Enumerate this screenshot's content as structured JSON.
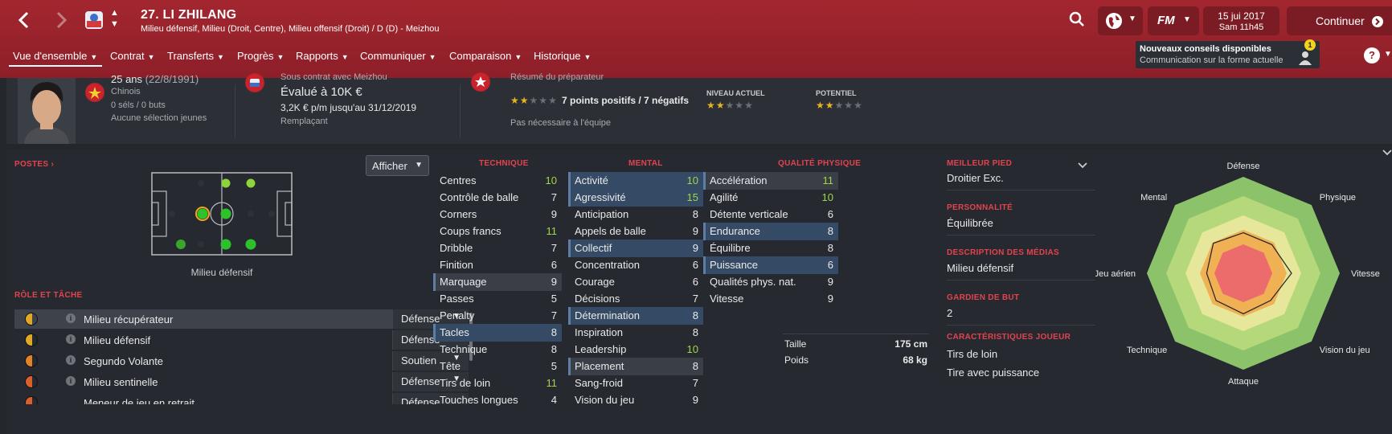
{
  "header": {
    "player_title": "27. LI ZHILANG",
    "player_positions": "Milieu défensif, Milieu (Droit, Centre), Milieu offensif (Droit) / D (D) - Meizhou",
    "date": "15 jui 2017",
    "time": "Sam 11h45",
    "continue_label": "Continuer",
    "fm_label": "FM",
    "back_icon": "chevron-left-icon",
    "forward_icon": "chevron-right-icon",
    "accent": "#a3262f"
  },
  "menu": [
    "Vue d'ensemble",
    "Contrat",
    "Transferts",
    "Progrès",
    "Rapports",
    "Communiquer",
    "Comparaison",
    "Historique"
  ],
  "tip": {
    "title": "Nouveaux conseils disponibles",
    "text": "Communication sur la forme actuelle",
    "count": "1"
  },
  "profile": {
    "age": "25 ans",
    "dob": "(22/8/1991)",
    "nationality": "Chinois",
    "caps": "0 séls / 0 buts",
    "youth": "Aucune sélection jeunes",
    "contract_with": "Sous contrat avec Meizhou",
    "value": "Évalué à 10K €",
    "wage": "3,2K € p/m jusqu'au 31/12/2019",
    "squad_status": "Remplaçant",
    "coach_summary_title": "Résumé du préparateur",
    "coach_summary": "7 points positifs / 7 négatifs",
    "coach_note": "Pas nécessaire à l'équipe",
    "current_ability_label": "NIVEAU ACTUEL",
    "potential_label": "POTENTIEL",
    "summary_stars": 1.5,
    "current_stars": 1.5,
    "potential_stars": 1.5
  },
  "positions": {
    "title": "POSTES",
    "show_button": "Afficher",
    "selected_label": "Milieu défensif"
  },
  "roles": {
    "title": "RÔLE ET TÂCHE",
    "items": [
      {
        "name": "Milieu récupérateur",
        "duty": "Défense"
      },
      {
        "name": "Milieu défensif",
        "duty": "Défense"
      },
      {
        "name": "Segundo Volante",
        "duty": "Soutien"
      },
      {
        "name": "Milieu sentinelle",
        "duty": "Défense"
      },
      {
        "name": "Meneur de jeu en retrait",
        "duty": "Défense"
      }
    ]
  },
  "technique": {
    "title": "TECHNIQUE",
    "rows": [
      {
        "n": "Centres",
        "v": "10"
      },
      {
        "n": "Contrôle de balle",
        "v": "7"
      },
      {
        "n": "Corners",
        "v": "9"
      },
      {
        "n": "Coups francs",
        "v": "11"
      },
      {
        "n": "Dribble",
        "v": "7"
      },
      {
        "n": "Finition",
        "v": "6"
      },
      {
        "n": "Marquage",
        "v": "9"
      },
      {
        "n": "Passes",
        "v": "5"
      },
      {
        "n": "Penalty",
        "v": "7"
      },
      {
        "n": "Tacles",
        "v": "8"
      },
      {
        "n": "Technique",
        "v": "8"
      },
      {
        "n": "Tête",
        "v": "5"
      },
      {
        "n": "Tirs de loin",
        "v": "11"
      },
      {
        "n": "Touches longues",
        "v": "4"
      }
    ]
  },
  "mental": {
    "title": "MENTAL",
    "rows": [
      {
        "n": "Activité",
        "v": "10"
      },
      {
        "n": "Agressivité",
        "v": "15"
      },
      {
        "n": "Anticipation",
        "v": "8"
      },
      {
        "n": "Appels de balle",
        "v": "9"
      },
      {
        "n": "Collectif",
        "v": "9"
      },
      {
        "n": "Concentration",
        "v": "6"
      },
      {
        "n": "Courage",
        "v": "6"
      },
      {
        "n": "Décisions",
        "v": "7"
      },
      {
        "n": "Détermination",
        "v": "8"
      },
      {
        "n": "Inspiration",
        "v": "8"
      },
      {
        "n": "Leadership",
        "v": "10"
      },
      {
        "n": "Placement",
        "v": "8"
      },
      {
        "n": "Sang-froid",
        "v": "7"
      },
      {
        "n": "Vision du jeu",
        "v": "9"
      }
    ]
  },
  "physical": {
    "title": "QUALITÉ PHYSIQUE",
    "rows": [
      {
        "n": "Accélération",
        "v": "11"
      },
      {
        "n": "Agilité",
        "v": "10"
      },
      {
        "n": "Détente verticale",
        "v": "6"
      },
      {
        "n": "Endurance",
        "v": "8"
      },
      {
        "n": "Équilibre",
        "v": "8"
      },
      {
        "n": "Puissance",
        "v": "6"
      },
      {
        "n": "Qualités phys. nat.",
        "v": "9"
      },
      {
        "n": "Vitesse",
        "v": "9"
      }
    ],
    "height_label": "Taille",
    "height": "175 cm",
    "weight_label": "Poids",
    "weight": "68 kg"
  },
  "info": {
    "foot_title": "MEILLEUR PIED",
    "foot": "Droitier Exc.",
    "personality_title": "PERSONNALITÉ",
    "personality": "Équilibrée",
    "media_title": "DESCRIPTION DES MÉDIAS",
    "media": "Milieu défensif",
    "gk_title": "GARDIEN DE BUT",
    "gk": "2",
    "traits_title": "CARACTÉRISTIQUES JOUEUR",
    "traits": [
      "Tirs de loin",
      "Tire avec puissance"
    ]
  },
  "radar": {
    "labels": [
      "Défense",
      "Physique",
      "Vitesse",
      "Vision du jeu",
      "Attaque",
      "Technique",
      "Jeu aérien",
      "Mental"
    ],
    "values": [
      0.42,
      0.42,
      0.5,
      0.4,
      0.42,
      0.4,
      0.38,
      0.44
    ]
  }
}
